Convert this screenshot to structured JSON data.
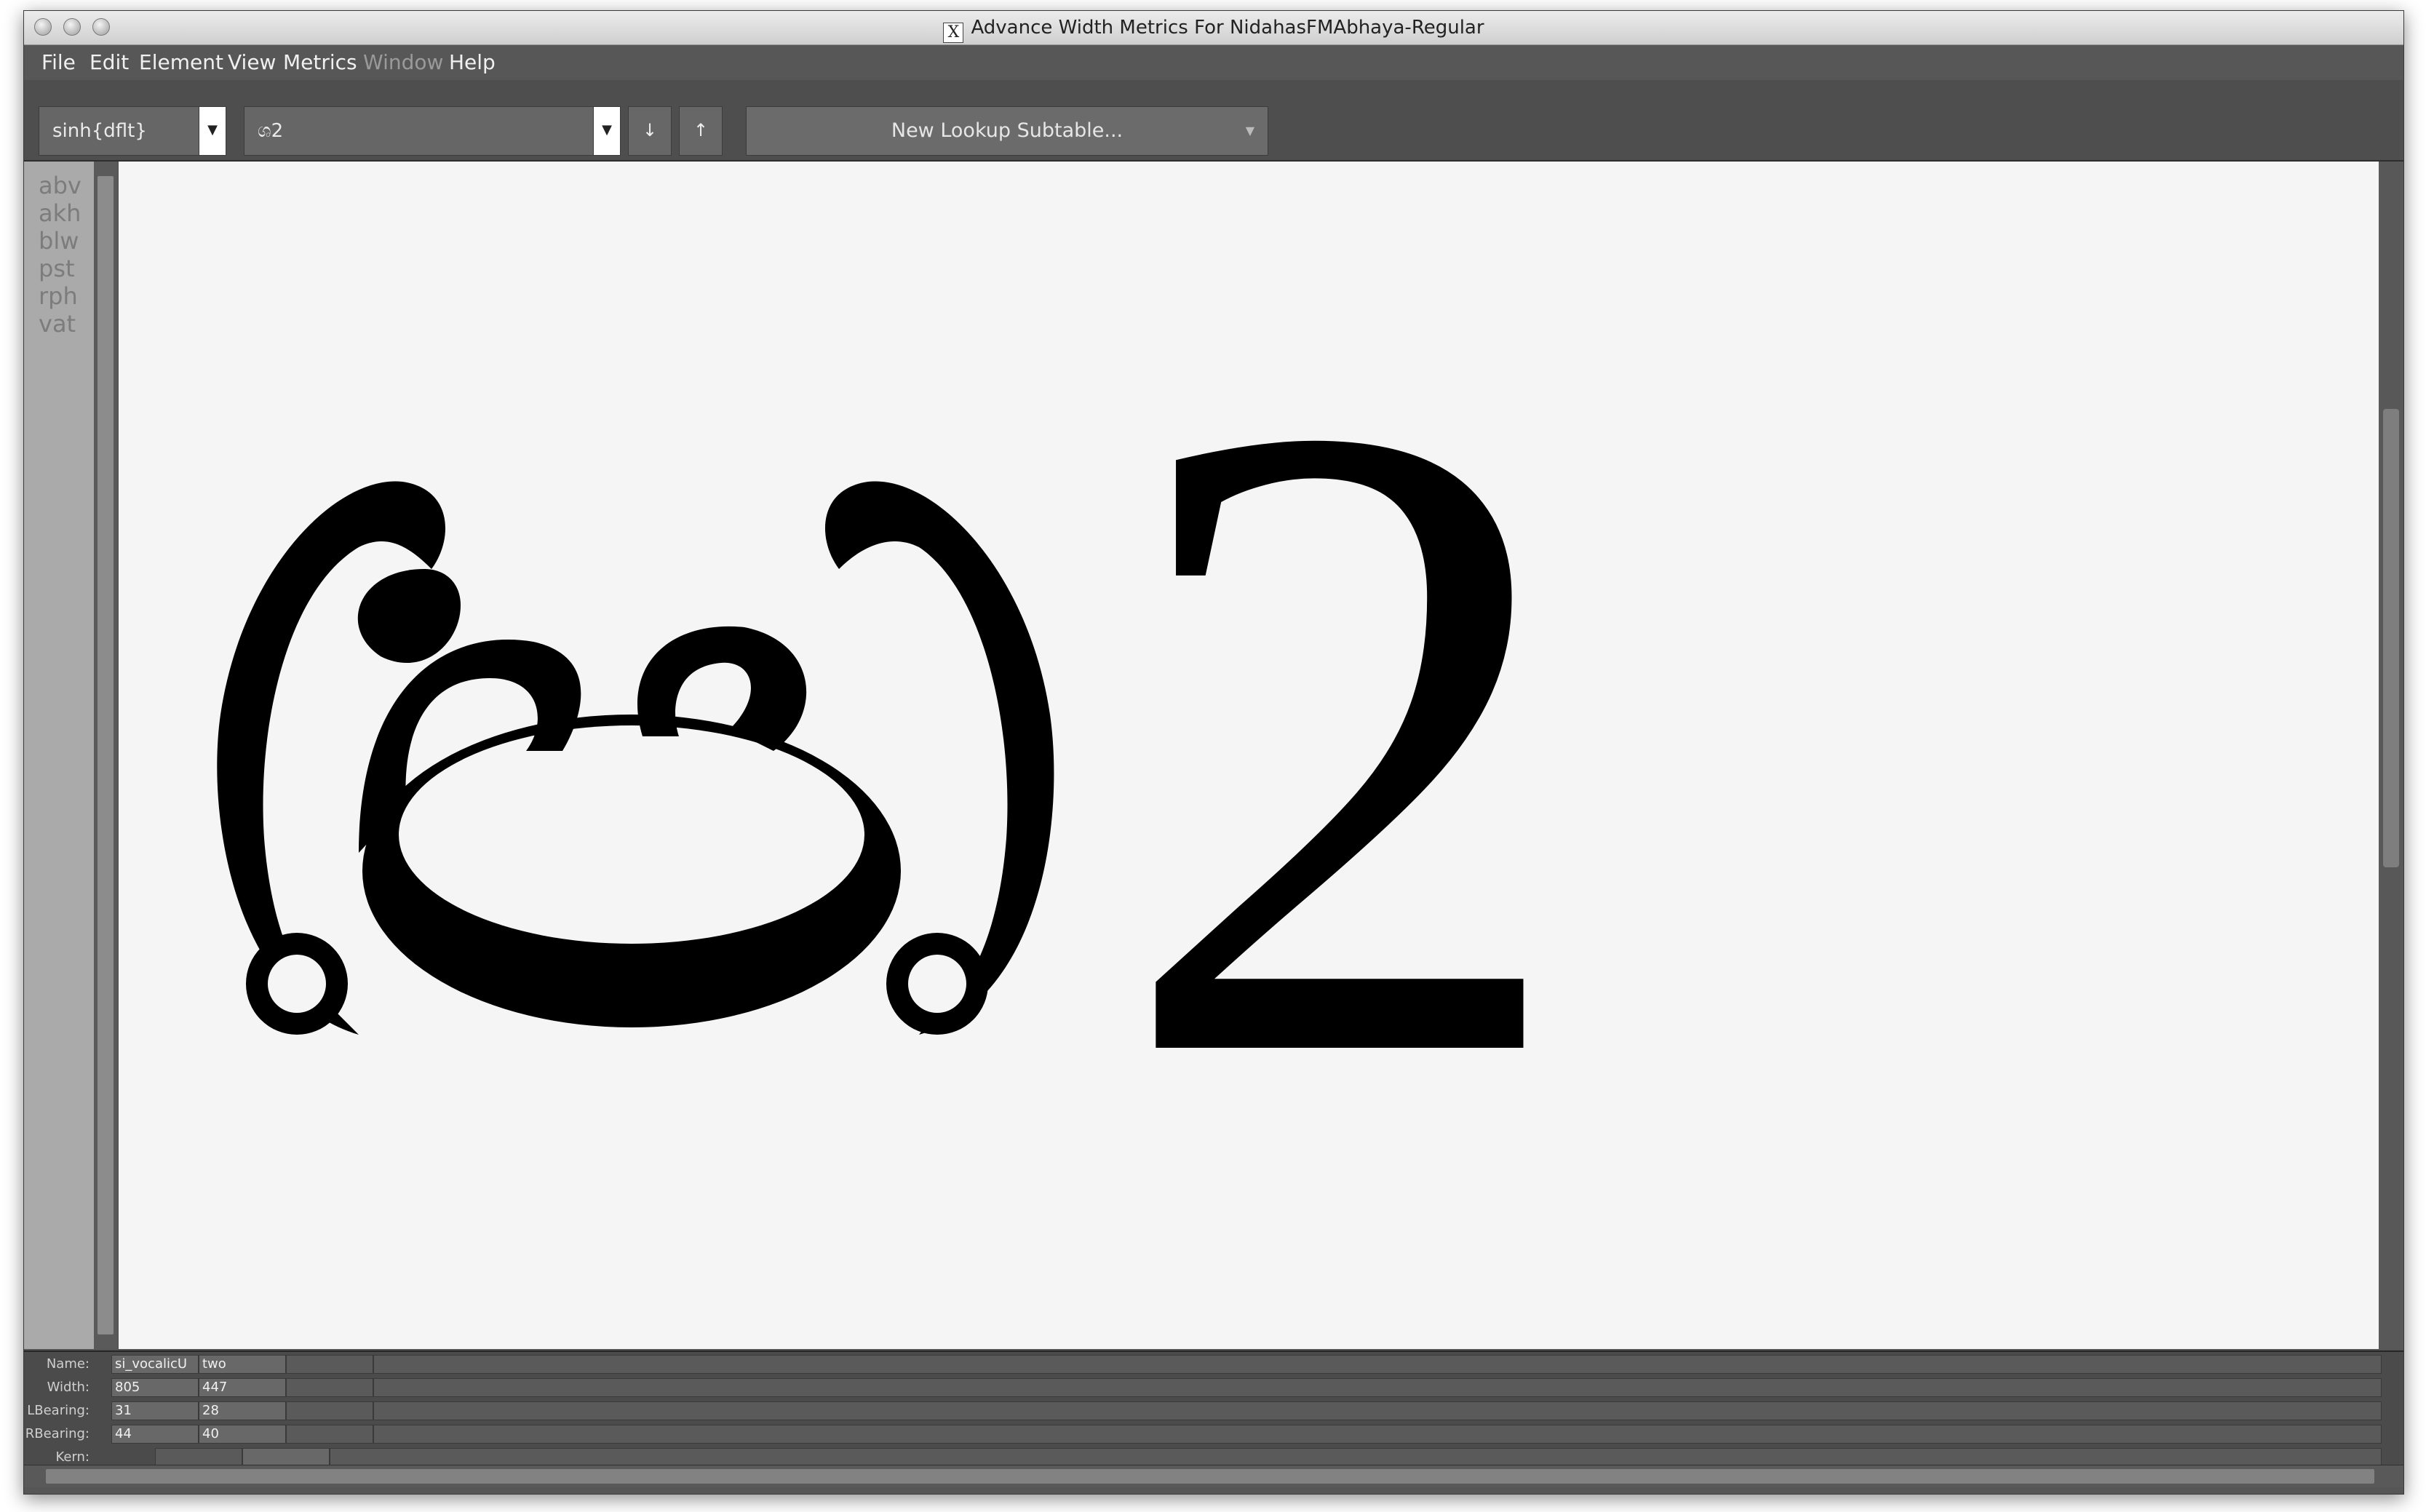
{
  "window": {
    "title": "Advance Width Metrics For NidahasFMAbhaya-Regular",
    "title_icon": "X"
  },
  "menu": [
    "File",
    "Edit",
    "Element",
    "View",
    "Metrics",
    "Window",
    "Help"
  ],
  "toolbar": {
    "script_combo": "sinh{dflt}",
    "text_combo": "ශ2",
    "btn_left_glyph": "↓",
    "btn_right_glyph": "↑",
    "lookup_label": "New Lookup Subtable..."
  },
  "features": [
    "abv",
    "akh",
    "blw",
    "pst",
    "rph",
    "vat"
  ],
  "canvas": {
    "glyph_text": "2"
  },
  "metrics": {
    "labels": {
      "name": "Name:",
      "width": "Width:",
      "lbearing": "LBearing:",
      "rbearing": "RBearing:",
      "kern": "Kern:"
    },
    "glyphs": [
      {
        "name": "si_vocalicU",
        "width": "805",
        "lbearing": "31",
        "rbearing": "44"
      },
      {
        "name": "two",
        "width": "447",
        "lbearing": "28",
        "rbearing": "40"
      }
    ]
  },
  "colors": {
    "window_bg": "#565656",
    "canvas_bg": "#f5f5f5",
    "glyph": "#000000"
  }
}
